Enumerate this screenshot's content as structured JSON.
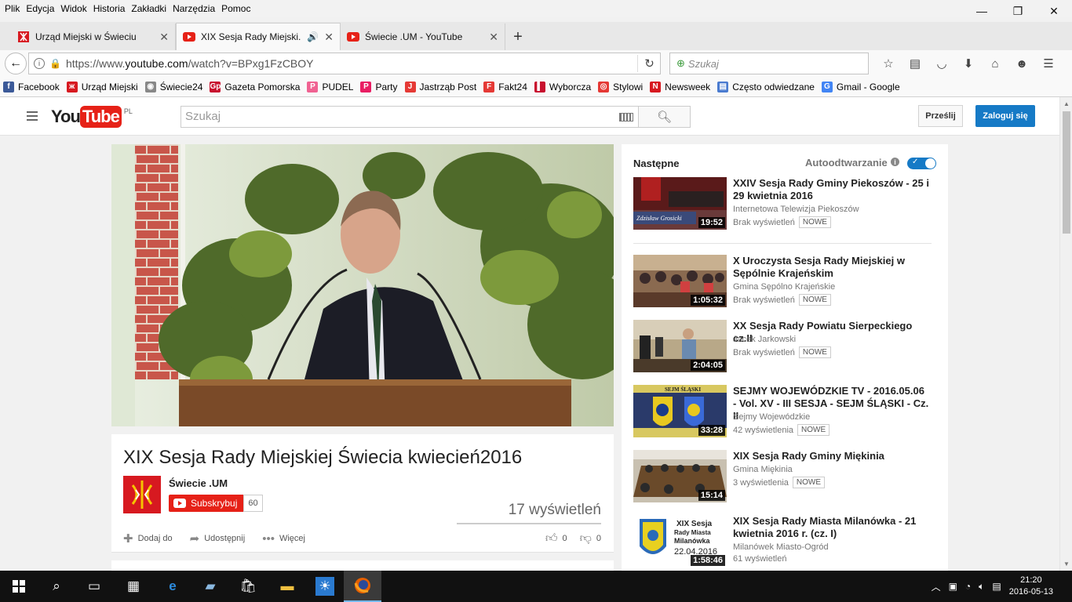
{
  "menu": [
    "Plik",
    "Edycja",
    "Widok",
    "Historia",
    "Zakładki",
    "Narzędzia",
    "Pomoc"
  ],
  "tabs": [
    {
      "title": "Urząd Miejski w Świeciu",
      "active": false,
      "audio": false
    },
    {
      "title": "XIX Sesja Rady Miejski...",
      "active": true,
      "audio": true
    },
    {
      "title": "Świecie .UM - YouTube",
      "active": false,
      "audio": false
    }
  ],
  "nav": {
    "url_prefix": "https://www.",
    "url_host": "youtube.com",
    "url_path": "/watch?v=BPxg1FzCBOY",
    "search_placeholder": "Szukaj"
  },
  "bookmarks": [
    {
      "label": "Facebook",
      "color": "#3b5998",
      "glyph": "f"
    },
    {
      "label": "Urząd Miejski",
      "color": "#d71920",
      "glyph": "ж"
    },
    {
      "label": "Świecie24",
      "color": "#888888",
      "glyph": "◉"
    },
    {
      "label": "Gazeta Pomorska",
      "color": "#c8102e",
      "glyph": "Gp"
    },
    {
      "label": "PUDEL",
      "color": "#f06292",
      "glyph": "P"
    },
    {
      "label": "Party",
      "color": "#e91e63",
      "glyph": "P"
    },
    {
      "label": "Jastrząb Post",
      "color": "#e53935",
      "glyph": "J"
    },
    {
      "label": "Fakt24",
      "color": "#e53935",
      "glyph": "F"
    },
    {
      "label": "Wyborcza",
      "color": "#c8102e",
      "glyph": "▌"
    },
    {
      "label": "Stylowi",
      "color": "#e53935",
      "glyph": "◎"
    },
    {
      "label": "Newsweek",
      "color": "#d71920",
      "glyph": "N"
    },
    {
      "label": "Często odwiedzane",
      "color": "#4a7bd0",
      "glyph": "▤"
    },
    {
      "label": "Gmail - Google",
      "color": "#4285f4",
      "glyph": "G"
    }
  ],
  "yt": {
    "logo_you": "You",
    "logo_tube": "Tube",
    "logo_region": "PL",
    "search_placeholder": "Szukaj",
    "upload_label": "Prześlij",
    "login_label": "Zaloguj się"
  },
  "video": {
    "title": "XIX Sesja Rady Miejskiej Świecia kwiecień2016",
    "channel": "Świecie .UM",
    "subscribe_label": "Subskrybuj",
    "subscriber_count": "60",
    "views": "17 wyświetleń",
    "actions": {
      "add": "Dodaj do",
      "share": "Udostępnij",
      "more": "Więcej"
    },
    "likes": "0",
    "dislikes": "0"
  },
  "sidebar": {
    "next_label": "Następne",
    "autoplay_label": "Autoodtwarzanie",
    "autoplay_on": true,
    "items": [
      {
        "title": "XXIV Sesja Rady Gminy Piekoszów - 25 i 29 kwietnia 2016",
        "channel": "Internetowa Telewizja Piekoszów",
        "views": "Brak wyświetleń",
        "badge": "NOWE",
        "duration": "19:52"
      },
      {
        "title": "X Uroczysta Sesja Rady Miejskiej w Sępólnie Krajeńskim",
        "channel": "Gmina Sępólno Krajeńskie",
        "views": "Brak wyświetleń",
        "badge": "NOWE",
        "duration": "1:05:32"
      },
      {
        "title": "XX Sesja Rady Powiatu Sierpeckiego cz.II",
        "channel": "Jacek Jarkowski",
        "views": "Brak wyświetleń",
        "badge": "NOWE",
        "duration": "2:04:05"
      },
      {
        "title": "SEJMY WOJEWÓDZKIE TV - 2016.05.06 - Vol. XV - III SESJA - SEJM ŚLĄSKI - Cz. II",
        "channel": "Sejmy Wojewódzkie",
        "views": "42 wyświetlenia",
        "badge": "NOWE",
        "duration": "33:28"
      },
      {
        "title": "XIX Sesja Rady Gminy Miękinia",
        "channel": "Gmina Miękinia",
        "views": "3 wyświetlenia",
        "badge": "NOWE",
        "duration": "15:14"
      },
      {
        "title": "XIX Sesja Rady Miasta Milanówka - 21 kwietnia 2016 r. (cz. I)",
        "channel": "Milanówek Miasto-Ogród",
        "views": "61 wyświetleń",
        "badge": "",
        "duration": "1:58:46"
      }
    ]
  },
  "thumb_text": {
    "t1_caption": "Zdzisław Grosicki",
    "t4_banner": "SEJM ŚLĄSKI",
    "t6_line1": "XIX Sesja",
    "t6_line2": "Rady Miasta",
    "t6_line3": "Milanówka",
    "t6_date": "22.04.2016"
  },
  "taskbar": {
    "time": "21:20",
    "date": "2016-05-13"
  }
}
